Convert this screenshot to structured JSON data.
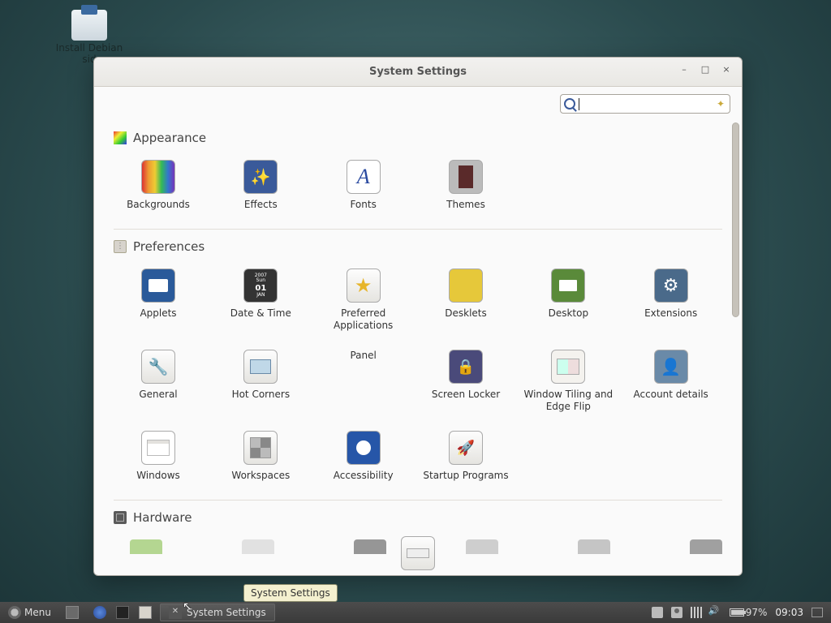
{
  "desktop": {
    "install_label": "Install Debian sid"
  },
  "window": {
    "title": "System Settings",
    "search_placeholder": ""
  },
  "sections": {
    "appearance": {
      "heading": "Appearance",
      "items": {
        "backgrounds": "Backgrounds",
        "effects": "Effects",
        "fonts": "Fonts",
        "themes": "Themes"
      }
    },
    "preferences": {
      "heading": "Preferences",
      "items": {
        "applets": "Applets",
        "datetime": "Date & Time",
        "prefapps": "Preferred Applications",
        "desklets": "Desklets",
        "desktop": "Desktop",
        "extensions": "Extensions",
        "general": "General",
        "hotcorners": "Hot Corners",
        "panel": "Panel",
        "locker": "Screen Locker",
        "tiling": "Window Tiling and Edge Flip",
        "account": "Account details",
        "windows": "Windows",
        "workspaces": "Workspaces",
        "a11y": "Accessibility",
        "startup": "Startup Programs"
      }
    },
    "hardware": {
      "heading": "Hardware"
    }
  },
  "tooltip": "System Settings",
  "panel": {
    "menu_label": "Menu",
    "task_label": "System Settings",
    "battery_pct": "97%",
    "clock": "09:03"
  },
  "datetime_mini": {
    "year": "2007",
    "dow": "Sun",
    "day": "01",
    "mon": "JAN"
  },
  "fonts_glyph": "A"
}
